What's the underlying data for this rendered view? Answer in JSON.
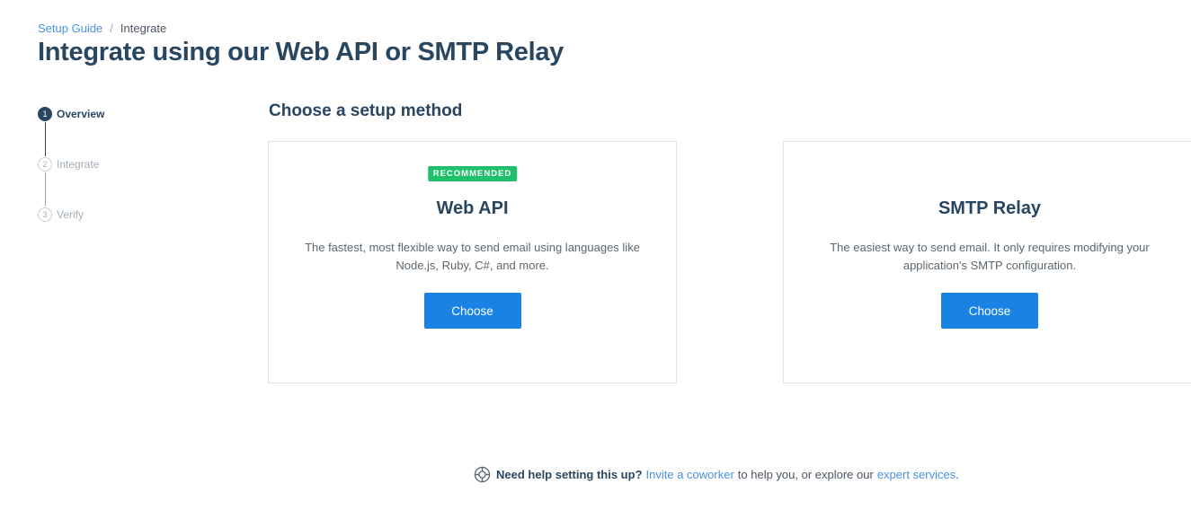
{
  "breadcrumb": {
    "parent": "Setup Guide",
    "separator": "/",
    "current": "Integrate"
  },
  "page_title": "Integrate using our Web API or SMTP Relay",
  "steps": [
    {
      "number": "1",
      "label": "Overview",
      "active": true
    },
    {
      "number": "2",
      "label": "Integrate",
      "active": false
    },
    {
      "number": "3",
      "label": "Verify",
      "active": false
    }
  ],
  "section_title": "Choose a setup method",
  "cards": {
    "web_api": {
      "badge": "RECOMMENDED",
      "title": "Web API",
      "description": "The fastest, most flexible way to send email using languages like Node.js, Ruby, C#, and more.",
      "button": "Choose"
    },
    "smtp": {
      "title": "SMTP Relay",
      "description": "The easiest way to send email. It only requires modifying your application's SMTP configuration.",
      "button": "Choose"
    }
  },
  "help": {
    "icon": "lifebuoy-icon",
    "bold": "Need help setting this up?",
    "link1": "Invite a coworker",
    "middle": "to help you, or explore our",
    "link2": "expert services",
    "end": "."
  },
  "colors": {
    "primary": "#1a82e2",
    "badge": "#1fbf6b",
    "heading": "#294661",
    "link": "#4a90e2"
  }
}
